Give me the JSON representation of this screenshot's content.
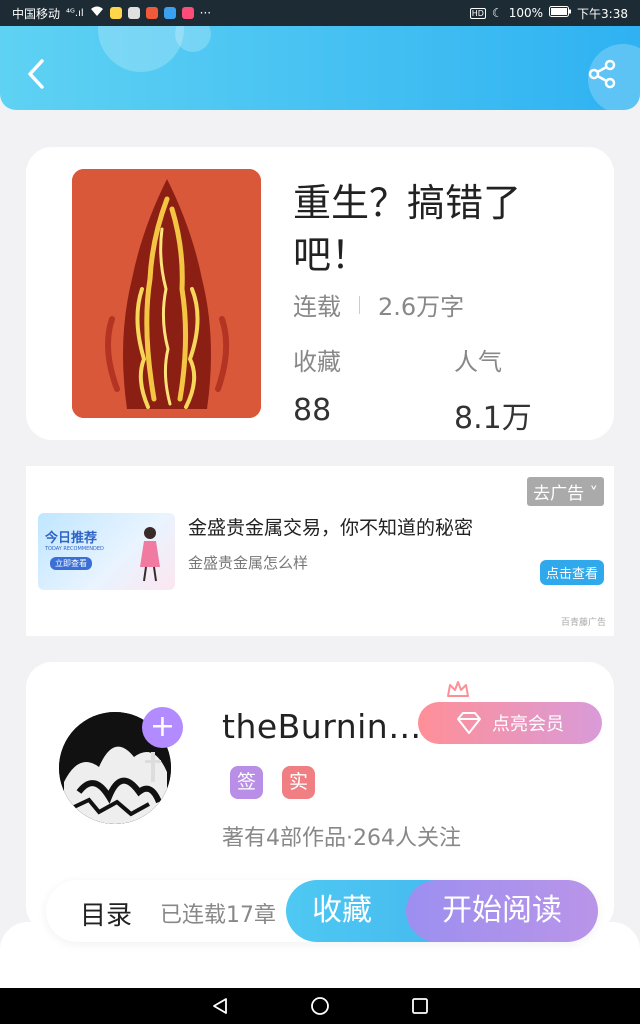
{
  "status_bar": {
    "carrier": "中国移动",
    "signal": "⁴ᴳ.ıl",
    "more": "···",
    "hd_badge": "HD",
    "battery": "100%",
    "time": "下午3:38"
  },
  "header": {
    "back_icon": "chevron-left-icon",
    "share_icon": "share-icon"
  },
  "book": {
    "title": "重生？搞错了吧！",
    "status": "连载",
    "word_count": "2.6万字",
    "favorites_label": "收藏",
    "favorites_value": "88",
    "popularity_label": "人气",
    "popularity_value": "8.1万"
  },
  "ad": {
    "close_label": "去广告 ˅",
    "image_title": "今日推荐",
    "image_subtitle": "TODAY RECOMMENDED",
    "image_cta": "立即查看",
    "title": "金盛贵金属交易，你不知道的秘密",
    "subtitle": "金盛贵金属怎么样",
    "cta": "点击查看",
    "source": "百青藤广告"
  },
  "author": {
    "name": "theBurnin…",
    "follow_label": "+",
    "vip_label": "点亮会员",
    "tag_signed": "签",
    "tag_verified": "实",
    "stats": "著有4部作品·264人关注"
  },
  "bottom_bar": {
    "toc_label": "目录",
    "chapters_label": "已连载17章",
    "collect_label": "收藏",
    "read_label": "开始阅读"
  },
  "colors": {
    "header_start": "#5fd2f3",
    "header_end": "#2fb2f2",
    "collect_btn": "#4fc8f3",
    "read_btn": "#a991ec",
    "vip_start": "#ff8f97",
    "vip_end": "#d99bd9"
  }
}
